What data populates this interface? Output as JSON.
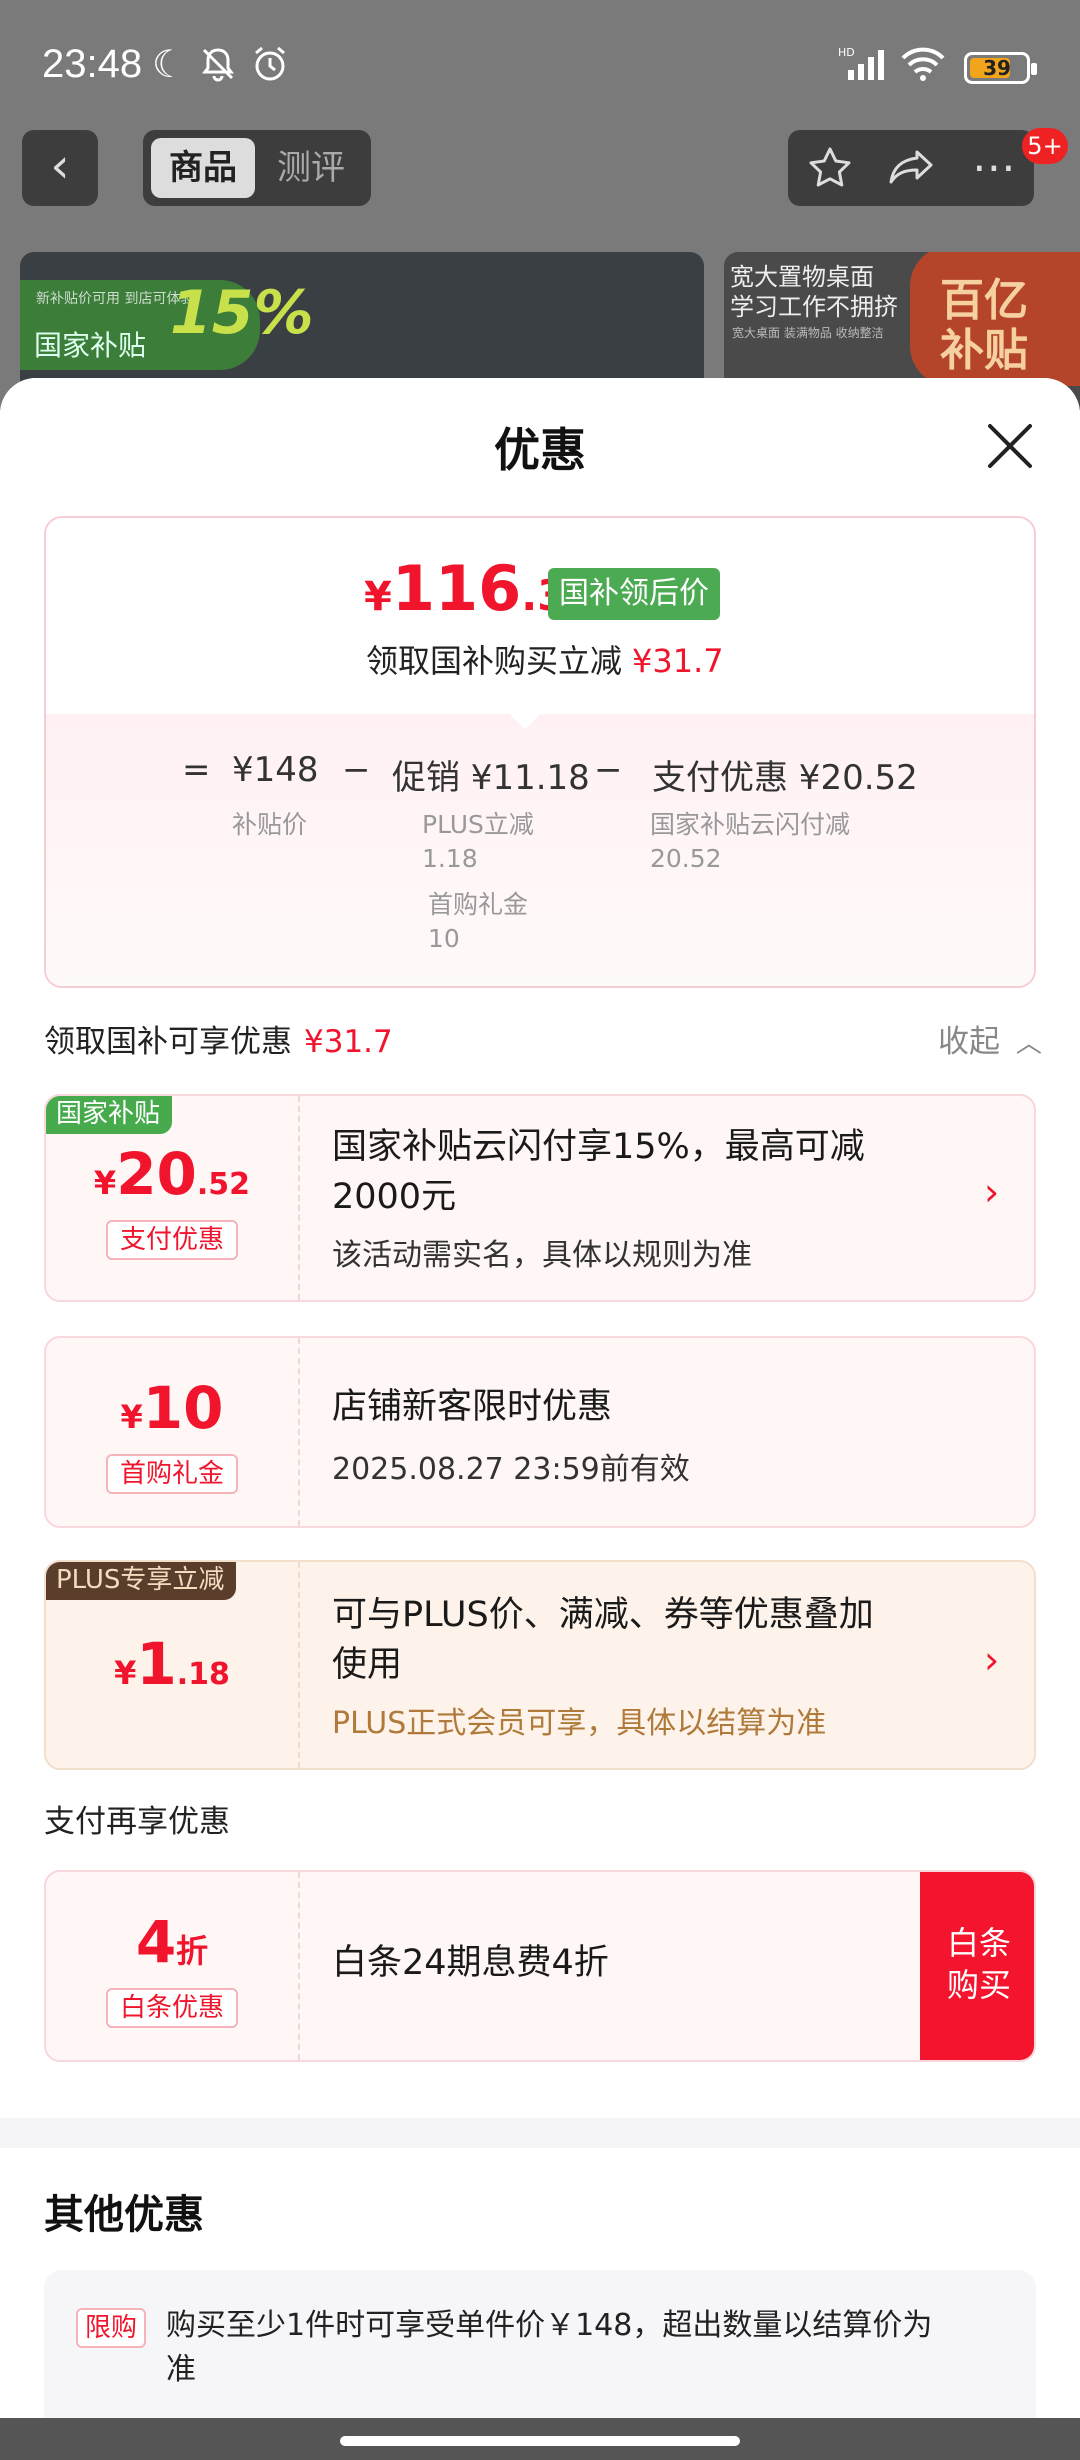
{
  "status_bar": {
    "time": "23:48",
    "battery": "39"
  },
  "nav": {
    "tab_product": "商品",
    "tab_review": "测评",
    "badge": "5+"
  },
  "banners": {
    "left": {
      "small": "新补贴价可用 到店可体验",
      "label": "国家补贴",
      "percent": "15%"
    },
    "right": {
      "line1": "宽大置物桌面",
      "line2": "学习工作不拥挤",
      "small": "宽大桌面 装满物品 收纳整洁",
      "badge": "百亿补贴"
    }
  },
  "sheet": {
    "title": "优惠",
    "summary": {
      "currency": "¥",
      "price_int": "116",
      "price_dec": ".3",
      "tag": "国补领后价",
      "save_text": "领取国补购买立减",
      "save_amount": "¥31.7",
      "eq": "=",
      "base_price": "¥148",
      "base_label": "补贴价",
      "minus1": "−",
      "promo": "促销 ¥11.18",
      "promo_note1_label": "PLUS立减",
      "promo_note1_value": "1.18",
      "promo_note2_label": "首购礼金",
      "promo_note2_value": "10",
      "minus2": "−",
      "pay": "支付优惠 ¥20.52",
      "pay_note_label": "国家补贴云闪付减",
      "pay_note_value": "20.52"
    },
    "section_title": "领取国补可享优惠",
    "section_amount": "¥31.7",
    "collapse": "收起",
    "cards": [
      {
        "corner": "国家补贴",
        "cur": "¥",
        "int": "20",
        "dec": ".52",
        "label": "支付优惠",
        "title_line1": "国家补贴云闪付享15%，最高可减",
        "title_line2": "2000元",
        "sub": "该活动需实名，具体以规则为准"
      },
      {
        "cur": "¥",
        "int": "10",
        "dec": "",
        "label": "首购礼金",
        "title_line1": "店铺新客限时优惠",
        "sub": "2025.08.27 23:59前有效"
      },
      {
        "corner": "PLUS专享立减",
        "cur": "¥",
        "int": "1",
        "dec": ".18",
        "title_line1": "可与PLUS价、满减、券等优惠叠加",
        "title_line2": "使用",
        "sub": "PLUS正式会员可享，具体以结算为准"
      }
    ],
    "pay_section_title": "支付再享优惠",
    "baitiao": {
      "int": "4",
      "unit": "折",
      "label": "白条优惠",
      "title": "白条24期息费4折",
      "button_line1": "白条",
      "button_line2": "购买"
    },
    "other": {
      "title": "其他优惠",
      "tag": "限购",
      "text": "购买至少1件时可享受单件价￥148，超出数量以结算价为准"
    }
  },
  "colors": {
    "accent_red": "#f0142c",
    "green": "#47ab4d",
    "plus_brown": "#5a3d2a"
  }
}
